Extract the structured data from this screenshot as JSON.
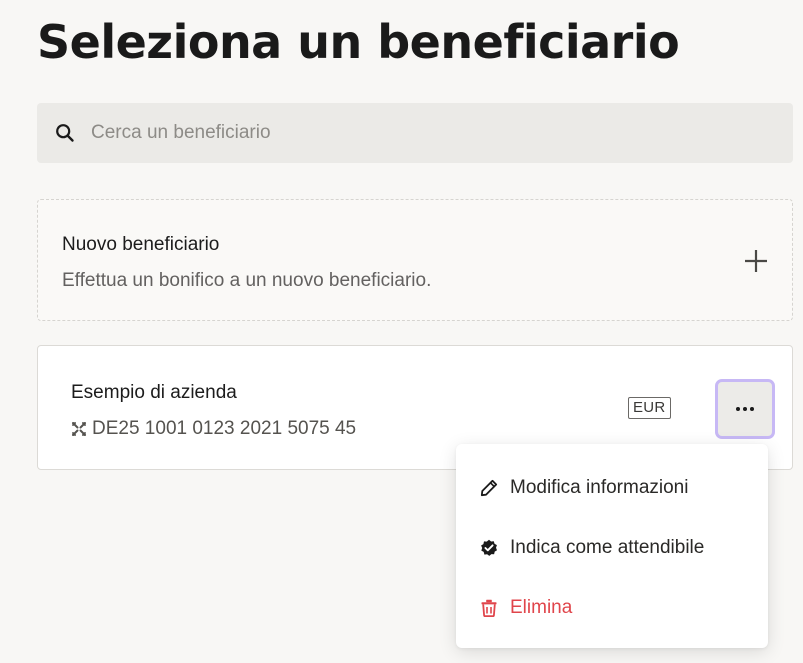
{
  "page": {
    "title": "Seleziona un beneficiario"
  },
  "search": {
    "placeholder": "Cerca un beneficiario",
    "icon": "search-icon"
  },
  "new_beneficiary": {
    "title": "Nuovo beneficiario",
    "subtitle": "Effettua un bonifico a un nuovo beneficiario.",
    "icon": "plus-icon"
  },
  "beneficiary": {
    "name": "Esempio di azienda",
    "iban": "DE25 1001 0123 2021 5075 45",
    "iban_icon": "iban-icon",
    "currency": "EUR",
    "more_icon": "more-icon"
  },
  "menu": {
    "items": [
      {
        "label": "Modifica informazioni",
        "icon": "pencil-icon",
        "color": "#2a2927"
      },
      {
        "label": "Indica come attendibile",
        "icon": "verified-icon",
        "color": "#2a2927"
      },
      {
        "label": "Elimina",
        "icon": "trash-icon",
        "color": "#e0454b"
      }
    ]
  },
  "colors": {
    "background": "#f8f7f5",
    "search_bg": "#ebeae7",
    "focus_ring": "#c7b8f5",
    "danger": "#e0454b"
  }
}
